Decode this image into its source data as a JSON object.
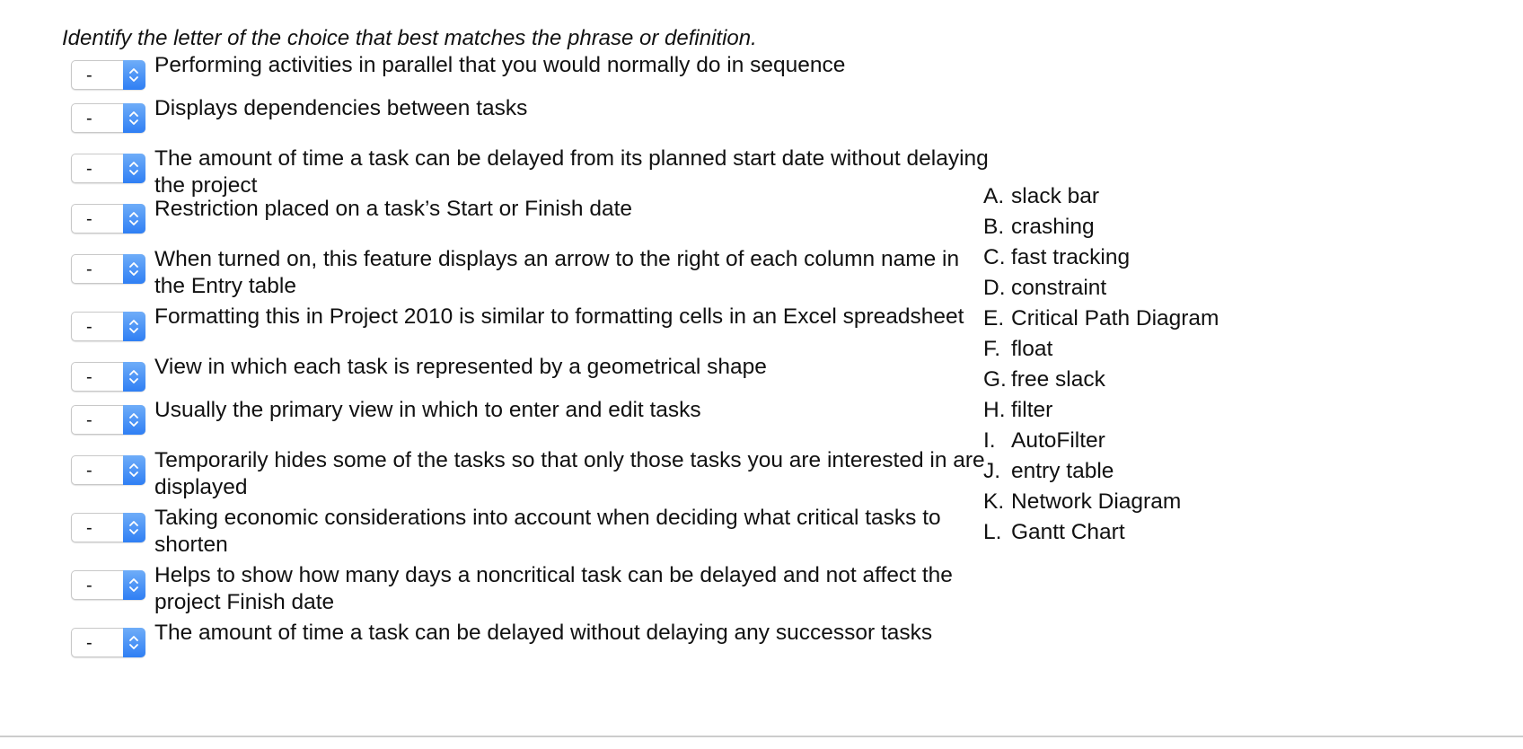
{
  "instructions": "Identify the letter of the choice that best matches the phrase or definition.",
  "questions": [
    {
      "selected": "-",
      "text": "Performing activities in parallel that you would normally do in sequence"
    },
    {
      "selected": "-",
      "text": "Displays dependencies between tasks"
    },
    {
      "selected": "-",
      "text": "The amount of time a task can be delayed from its planned start date without delaying the project"
    },
    {
      "selected": "-",
      "text": "Restriction placed on a task’s Start or Finish date"
    },
    {
      "selected": "-",
      "text": "When turned on, this feature displays an arrow to the right of each column name in the Entry table"
    },
    {
      "selected": "-",
      "text": "Formatting this in Project 2010 is similar to formatting cells in an Excel spreadsheet"
    },
    {
      "selected": "-",
      "text": "View in which each task is represented by a geometrical shape"
    },
    {
      "selected": "-",
      "text": "Usually the primary view in which to enter and edit tasks"
    },
    {
      "selected": "-",
      "text": "Temporarily hides some of the tasks so that only those tasks you are interested in are displayed"
    },
    {
      "selected": "-",
      "text": "Taking economic considerations into account when deciding what critical tasks to shorten"
    },
    {
      "selected": "-",
      "text": "Helps to show how many days a noncritical task can be delayed and not affect the project Finish date"
    },
    {
      "selected": "-",
      "text": "The amount of time a task can be delayed without delaying any successor tasks"
    }
  ],
  "choices": [
    {
      "letter": "A.",
      "text": "slack bar"
    },
    {
      "letter": "B.",
      "text": "crashing"
    },
    {
      "letter": "C.",
      "text": "fast tracking"
    },
    {
      "letter": "D.",
      "text": "constraint"
    },
    {
      "letter": "E.",
      "text": "Critical Path Diagram"
    },
    {
      "letter": "F.",
      "text": "float"
    },
    {
      "letter": "G.",
      "text": "free slack"
    },
    {
      "letter": "H.",
      "text": "filter"
    },
    {
      "letter": "I.",
      "text": "AutoFilter"
    },
    {
      "letter": "J.",
      "text": "entry table"
    },
    {
      "letter": "K.",
      "text": "Network Diagram"
    },
    {
      "letter": "L.",
      "text": "Gantt Chart"
    }
  ],
  "colors": {
    "stepper_top": "#6fadf8",
    "stepper_bottom": "#2f7ff4",
    "divider": "#cccccc"
  }
}
